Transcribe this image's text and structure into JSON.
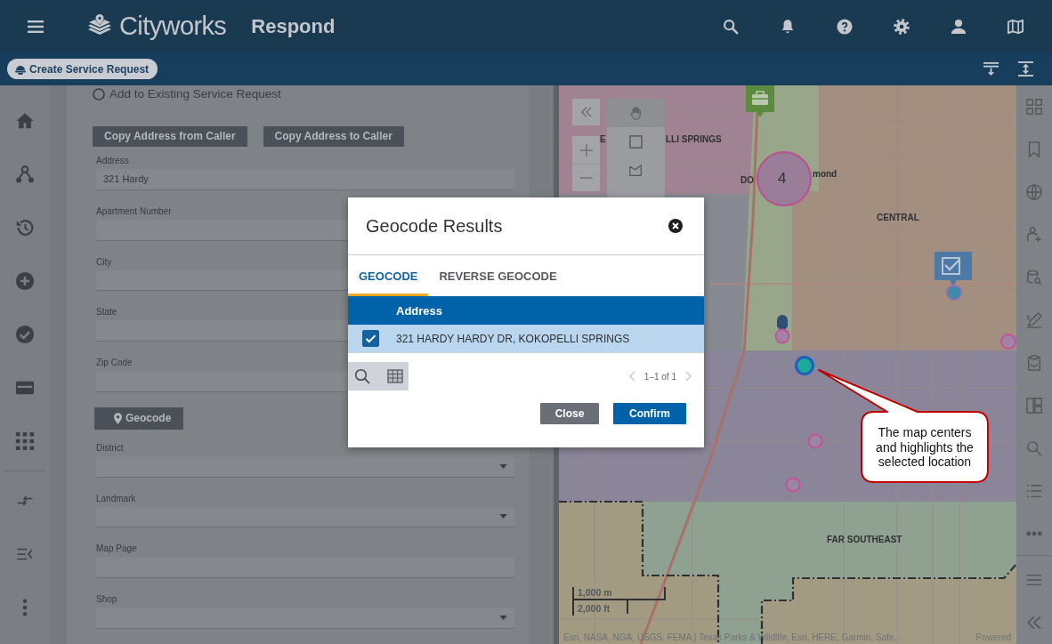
{
  "header": {
    "logo": "Cityworks",
    "product": "Respond"
  },
  "subbar": {
    "create_button": "Create Service Request"
  },
  "form": {
    "radio": {
      "label": "Add to Existing Service Request",
      "selected": false
    },
    "copy_buttons": [
      "Copy Address from Caller",
      "Copy Address to Caller"
    ],
    "fields": [
      {
        "kind": "text",
        "label": "Address",
        "value": "321 Hardy"
      },
      {
        "kind": "text",
        "label": "Apartment Number"
      },
      {
        "kind": "text",
        "label": "City"
      },
      {
        "kind": "text",
        "label": "State"
      },
      {
        "kind": "text",
        "label": "Zip Code"
      },
      {
        "kind": "button",
        "label": "Geocode"
      },
      {
        "kind": "select",
        "label": "District"
      },
      {
        "kind": "select",
        "label": "Landmark"
      },
      {
        "kind": "text",
        "label": "Map Page"
      },
      {
        "kind": "select",
        "label": "Shop"
      }
    ]
  },
  "map": {
    "tools": [
      {
        "kind": "pan",
        "selected": true
      },
      {
        "kind": "rectangle",
        "selected": false
      },
      {
        "kind": "polygon",
        "selected": false
      }
    ],
    "labels": [
      "E",
      "LLI SPRINGS",
      "DO",
      "mond",
      "CENTRAL",
      "FAR SOUTHEAST"
    ],
    "cluster_count": "4",
    "scale": [
      "1,000 m",
      "2,000 ft"
    ],
    "attribution": "Esri, NASA, NGA, USGS, FEMA | Texas Parks & Wildlife, Esri, HERE, Garmin, Safe…",
    "powered": "Powered"
  },
  "dialog": {
    "title": "Geocode Results",
    "tabs": [
      {
        "label": "GEOCODE",
        "selected": true
      },
      {
        "label": "REVERSE GEOCODE",
        "selected": false
      }
    ],
    "table": {
      "columns": [
        "Address"
      ],
      "rows": [
        {
          "selected": true,
          "checked": true,
          "cells": [
            "321 HARDY HARDY DR, KOKOPELLI SPRINGS"
          ]
        }
      ]
    },
    "pagination": {
      "label": "1–1 of 1",
      "prev": {
        "disabled": true
      },
      "next": {
        "disabled": true
      }
    },
    "buttons": [
      {
        "kind": "secondary",
        "label": "Close"
      },
      {
        "kind": "primary",
        "label": "Confirm"
      }
    ]
  },
  "callout": {
    "text": "The map centers and highlights the selected location"
  }
}
